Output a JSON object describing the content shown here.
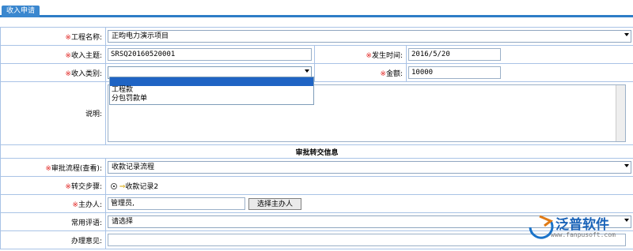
{
  "tab": "收入申请",
  "project": {
    "label": "工程名称:",
    "value": "正昀电力演示项目"
  },
  "subject": {
    "label": "收入主题:",
    "value": "SRSQ20160520001"
  },
  "date": {
    "label": "发生时间:",
    "value": "2016/5/20"
  },
  "category": {
    "label": "收入类别:",
    "value": "",
    "options": [
      "工程款",
      "分包罚款单"
    ]
  },
  "amount": {
    "label": "金额:",
    "value": "10000"
  },
  "note_label": "说明:",
  "section_title": "审批转交信息",
  "flow": {
    "label": "审批流程",
    "view": "(查看)",
    "colon": ":",
    "value": "收款记录流程"
  },
  "step": {
    "label": "转交步骤:",
    "value": "收款记录2"
  },
  "host": {
    "label": "主办人:",
    "value": "管理员,",
    "button": "选择主办人"
  },
  "comment": {
    "label": "常用评语:",
    "value": "请选择"
  },
  "opinion": {
    "label": "办理意见:"
  },
  "required_mark": "※",
  "logo": {
    "name": "泛普软件",
    "url": "www.fanpusoft.com"
  }
}
